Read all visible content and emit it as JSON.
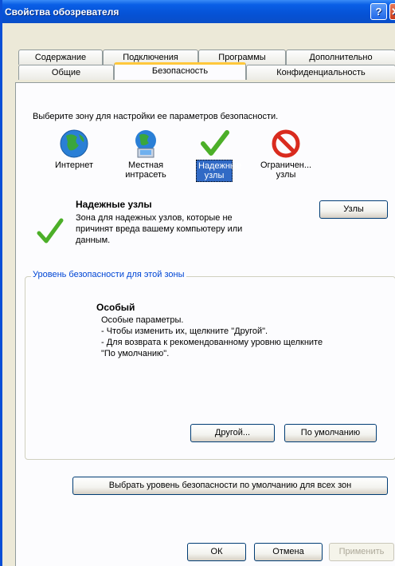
{
  "window": {
    "title": "Свойства обозревателя",
    "help_glyph": "?",
    "close_glyph": "✕"
  },
  "tabs": {
    "row1": [
      "Содержание",
      "Подключения",
      "Программы",
      "Дополнительно"
    ],
    "row2": [
      "Общие",
      "Безопасность",
      "Конфиденциальность"
    ],
    "active": "Безопасность"
  },
  "security": {
    "zone_prompt": "Выберите зону для настройки ее параметров безопасности.",
    "zones": [
      {
        "icon": "globe-icon",
        "label": "Интернет"
      },
      {
        "icon": "local-intranet-icon",
        "label": "Местная интрасеть"
      },
      {
        "icon": "checkmark-icon",
        "label": "Надежные узлы",
        "selected": true
      },
      {
        "icon": "restricted-icon",
        "label": "Ограничен... узлы"
      }
    ],
    "selected_zone": {
      "title": "Надежные узлы",
      "description": "Зона для надежных узлов, которые не причинят вреда вашему компьютеру или данным.",
      "sites_button": "Узлы"
    },
    "level_group": {
      "label": "Уровень безопасности для этой зоны",
      "level_title": "Особый",
      "level_lines": [
        "Особые параметры.",
        "- Чтобы изменить их, щелкните \"Другой\".",
        "- Для возврата к рекомендованному уровню щелкните",
        "\"По умолчанию\"."
      ],
      "custom_button": "Другой...",
      "default_button": "По умолчанию"
    },
    "reset_all_button": "Выбрать уровень безопасности по умолчанию для всех зон"
  },
  "footer": {
    "ok": "ОК",
    "cancel": "Отмена",
    "apply": "Применить"
  },
  "colors": {
    "titlebar": "#0552d6",
    "selection": "#316ac5",
    "group_label": "#0046d5",
    "check_green": "#4caf28",
    "restricted_red": "#d92b1e"
  }
}
